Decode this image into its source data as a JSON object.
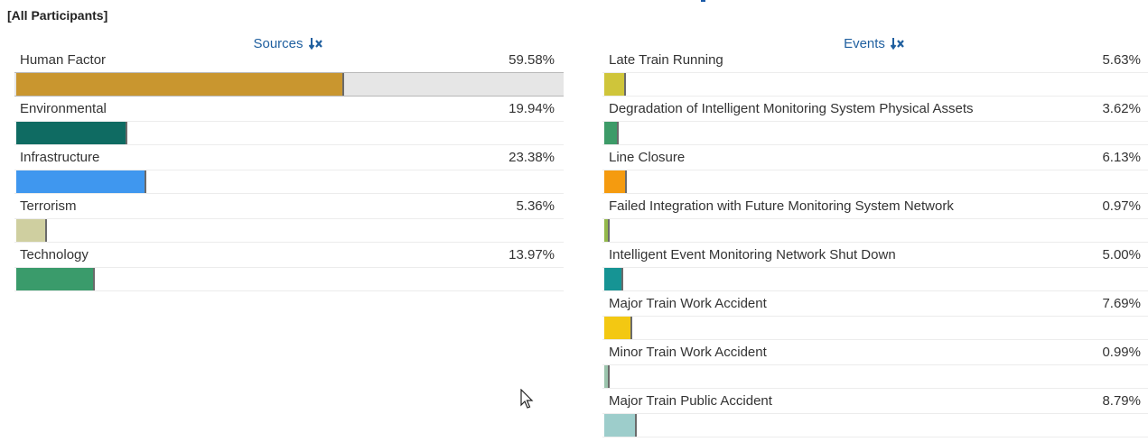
{
  "filter_label": "[All Participants]",
  "sources_header": "Sources",
  "events_header": "Events",
  "colors": {
    "header_text": "#1f5f9f",
    "sort_icon": "#1f5f9f"
  },
  "icons": {
    "sort": "sort-descending-icon",
    "cursor": "mouse-pointer-icon"
  },
  "chart_data": [
    {
      "type": "bar",
      "orientation": "horizontal",
      "title": "Sources",
      "categories": [
        "Human Factor",
        "Environmental",
        "Infrastructure",
        "Terrorism",
        "Technology"
      ],
      "values": [
        59.58,
        19.94,
        23.38,
        5.36,
        13.97
      ],
      "value_labels": [
        "59.58%",
        "19.94%",
        "23.38%",
        "5.36%",
        "13.97%"
      ],
      "colors": [
        "#c9962f",
        "#0f6b62",
        "#3f97ef",
        "#cfcfa0",
        "#3a9b6b"
      ],
      "xlim": [
        0,
        100
      ],
      "grid": false,
      "legend": "none"
    },
    {
      "type": "bar",
      "orientation": "horizontal",
      "title": "Events",
      "categories": [
        "Late Train Running",
        "Degradation of Intelligent Monitoring System Physical Assets",
        "Line Closure",
        "Failed Integration with Future Monitoring System Network",
        "Intelligent Event Monitoring Network Shut Down",
        "Major Train Work Accident",
        "Minor Train Work Accident",
        "Major Train Public Accident"
      ],
      "values": [
        5.63,
        3.62,
        6.13,
        0.97,
        5.0,
        7.69,
        0.99,
        8.79
      ],
      "value_labels": [
        "5.63%",
        "3.62%",
        "6.13%",
        "0.97%",
        "5.00%",
        "7.69%",
        "0.99%",
        "8.79%"
      ],
      "colors": [
        "#cfc53a",
        "#3d9b68",
        "#f59b0f",
        "#93b84a",
        "#169494",
        "#f3c812",
        "#9bc4ad",
        "#9dcdcb"
      ],
      "xlim": [
        0,
        100
      ],
      "grid": false,
      "legend": "none"
    }
  ]
}
